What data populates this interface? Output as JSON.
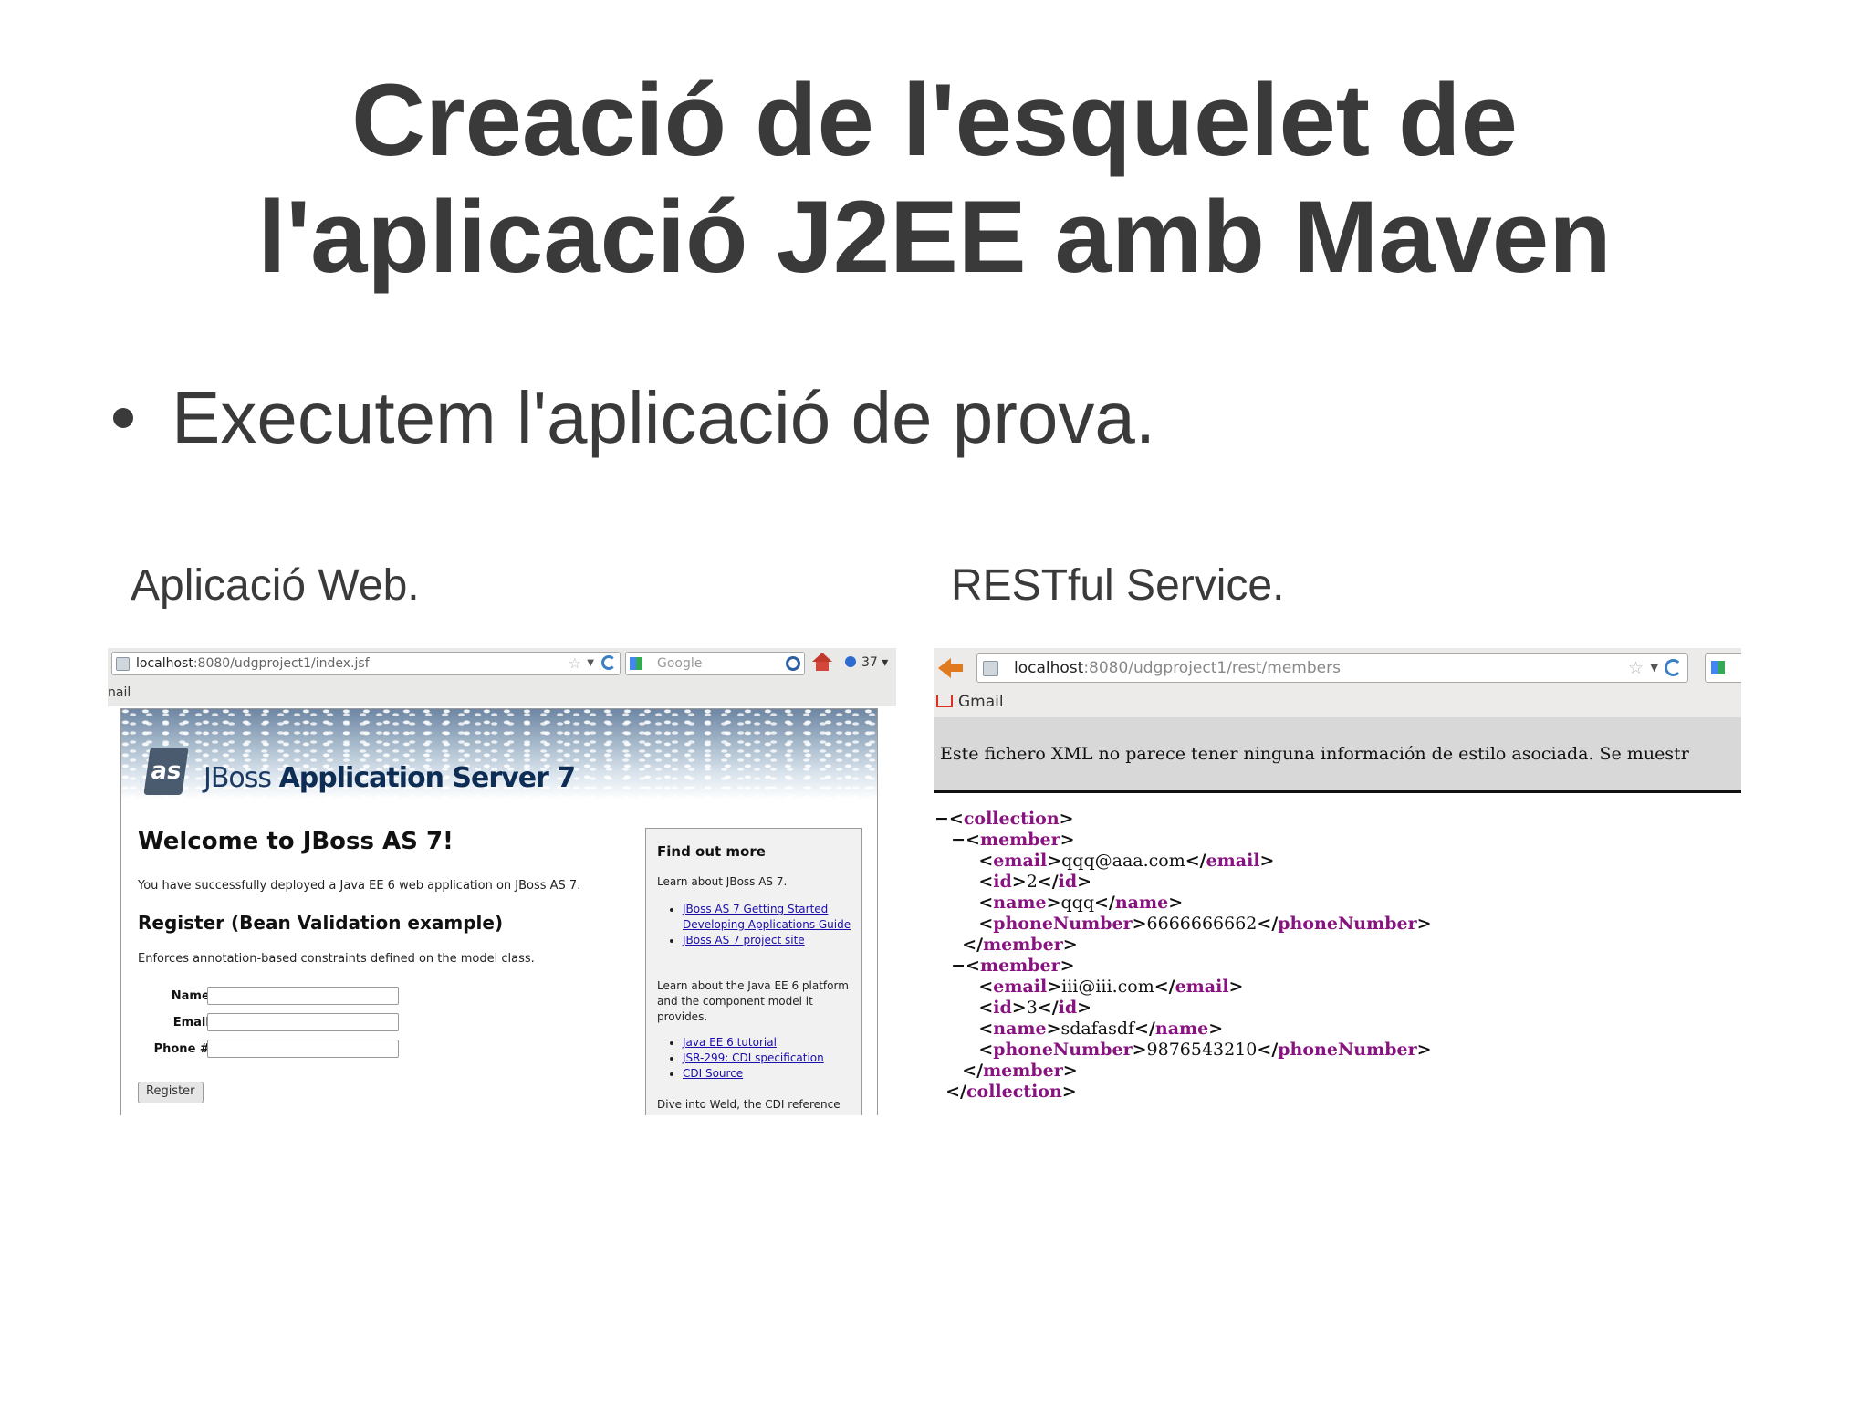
{
  "slide": {
    "title_line1": "Creació de l'esquelet de",
    "title_line2": "l'aplicació J2EE amb Maven",
    "bullet": "Executem l'aplicació de prova.",
    "caption_left": "Aplicació Web.",
    "caption_right": "RESTful Service."
  },
  "left_browser": {
    "url_host": "localhost",
    "url_rest": ":8080/udgproject1/index.jsf",
    "search_placeholder": "Google",
    "tab_count": "37",
    "bookmark": "nail",
    "page": {
      "brand_light": "JBoss ",
      "brand_strong": "Application Server 7",
      "logo_text": "as",
      "heading": "Welcome to JBoss AS 7!",
      "intro": "You have successfully deployed a Java EE 6 web application on JBoss AS 7.",
      "register_heading": "Register (Bean Validation example)",
      "register_desc": "Enforces annotation-based constraints defined on the model class.",
      "name_label": "Name:",
      "email_label": "Email:",
      "phone_label": "Phone #:",
      "register_button": "Register",
      "find_out_more": {
        "title": "Find out more",
        "text1": "Learn about JBoss AS 7.",
        "links1": [
          "JBoss AS 7 Getting Started Developing Applications Guide",
          "JBoss AS 7 project site"
        ],
        "text2": "Learn about the Java EE 6 platform and the component model it provides.",
        "links2": [
          "Java EE 6 tutorial",
          "JSR-299: CDI specification",
          "CDI Source"
        ],
        "text3": "Dive into Weld, the CDI reference"
      }
    }
  },
  "right_browser": {
    "url_host": "localhost",
    "url_rest": ":8080/udgproject1/rest/members",
    "bookmark": "Gmail",
    "xml_notice": "Este fichero XML no parece tener ninguna información de estilo asociada. Se muestr",
    "xml": {
      "collection_tag": "collection",
      "member_tag": "member",
      "members": [
        {
          "email": "qqq@aaa.com",
          "id": "2",
          "name": "qqq",
          "phoneNumber": "6666666662"
        },
        {
          "email": "iii@iii.com",
          "id": "3",
          "name": "sdafasdf",
          "phoneNumber": "9876543210"
        }
      ],
      "fields": {
        "email": "email",
        "id": "id",
        "name": "name",
        "phone": "phoneNumber"
      }
    }
  },
  "colors": {
    "text": "#3a3a3a",
    "xml_tag": "#881280",
    "link": "#1a0dab"
  }
}
